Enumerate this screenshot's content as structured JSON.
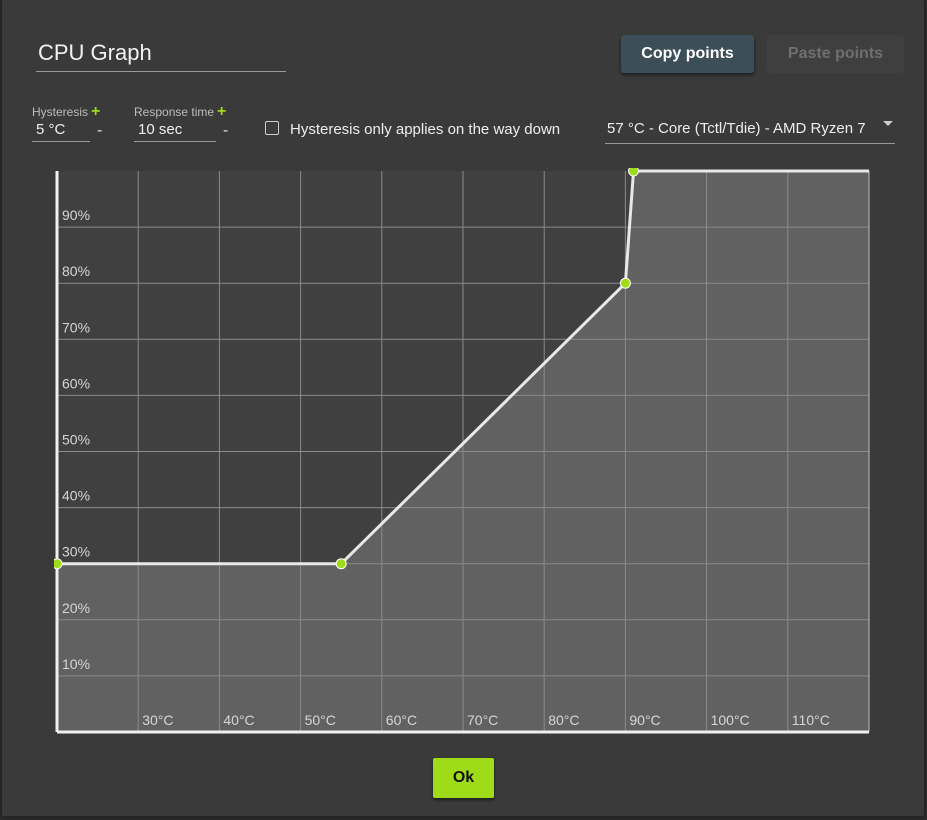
{
  "dialog": {
    "title": "CPU Graph",
    "copy_label": "Copy points",
    "paste_label": "Paste points",
    "ok_label": "Ok"
  },
  "settings": {
    "hysteresis_label": "Hysteresis",
    "hysteresis_value": "5 °C",
    "response_label": "Response time",
    "response_value": "10 sec",
    "plus_symbol": "+",
    "minus_symbol": "-",
    "checkbox_label": "Hysteresis only applies on the way down",
    "checkbox_checked": false,
    "sensor_value": "57 °C - Core (Tctl/Tdie) - AMD Ryzen 7"
  },
  "colors": {
    "accent": "#9edc1a",
    "curve": "#e8e8e8",
    "fill": "#616161",
    "grid": "#8a8a8a",
    "plot_bg": "#404040"
  },
  "chart_data": {
    "type": "line",
    "xlim": [
      20,
      120
    ],
    "ylim": [
      0,
      100
    ],
    "x_ticks": [
      "30°C",
      "40°C",
      "50°C",
      "60°C",
      "70°C",
      "80°C",
      "90°C",
      "100°C",
      "110°C"
    ],
    "y_ticks": [
      "10%",
      "20%",
      "30%",
      "40%",
      "50%",
      "60%",
      "70%",
      "80%",
      "90%"
    ],
    "points": [
      {
        "x": 20,
        "y": 30
      },
      {
        "x": 55,
        "y": 30
      },
      {
        "x": 90,
        "y": 80
      },
      {
        "x": 91,
        "y": 100
      }
    ],
    "grid": true
  }
}
